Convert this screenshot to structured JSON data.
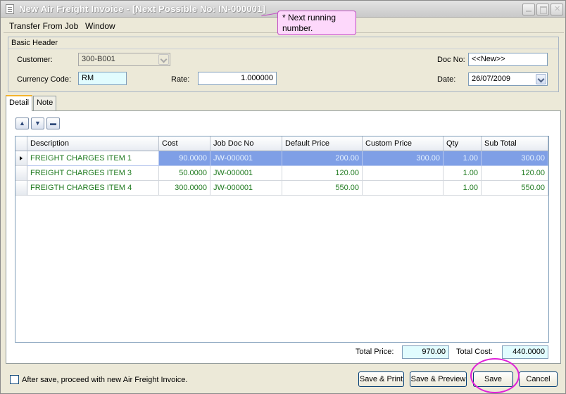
{
  "window": {
    "title": "New Air Freight Invoice  - [Next Possible No: IN-000001]"
  },
  "tooltip": {
    "text": "* Next running number."
  },
  "menu": {
    "items": [
      "Transfer From Job",
      "Window"
    ]
  },
  "header": {
    "group_title": "Basic Header",
    "customer_label": "Customer:",
    "customer_value": "300-B001",
    "currency_label": "Currency Code:",
    "currency_value": "RM",
    "rate_label": "Rate:",
    "rate_value": "1.000000",
    "docno_label": "Doc No:",
    "docno_value": "<<New>>",
    "date_label": "Date:",
    "date_value": "26/07/2009"
  },
  "tabs": {
    "detail": "Detail",
    "note": "Note"
  },
  "toolbar": {
    "icons": [
      "move-up-icon",
      "move-down-icon",
      "delete-row-icon"
    ]
  },
  "grid": {
    "columns": [
      "Description",
      "Cost",
      "Job Doc No",
      "Default Price",
      "Custom Price",
      "Qty",
      "Sub Total"
    ],
    "rows": [
      [
        "FREIGHT CHARGES ITEM 1",
        "90.0000",
        "JW-000001",
        "200.00",
        "300.00",
        "1.00",
        "300.00"
      ],
      [
        "FREIGHT CHARGES ITEM 3",
        "50.0000",
        "JW-000001",
        "120.00",
        "",
        "1.00",
        "120.00"
      ],
      [
        "FREIGTH CHARGES ITEM 4",
        "300.0000",
        "JW-000001",
        "550.00",
        "",
        "1.00",
        "550.00"
      ]
    ]
  },
  "totals": {
    "price_label": "Total Price:",
    "price_value": "970.00",
    "cost_label": "Total Cost:",
    "cost_value": "440.0000"
  },
  "footer": {
    "checkbox_label": "After save, proceed with new Air Freight Invoice.",
    "save_print": "Save & Print",
    "save_preview": "Save & Preview",
    "save": "Save",
    "cancel": "Cancel"
  },
  "colors": {
    "highlight_circle": "#e020d8",
    "selected_row": "#7f9fe6",
    "tooltip_bg": "#fdd8fb"
  }
}
